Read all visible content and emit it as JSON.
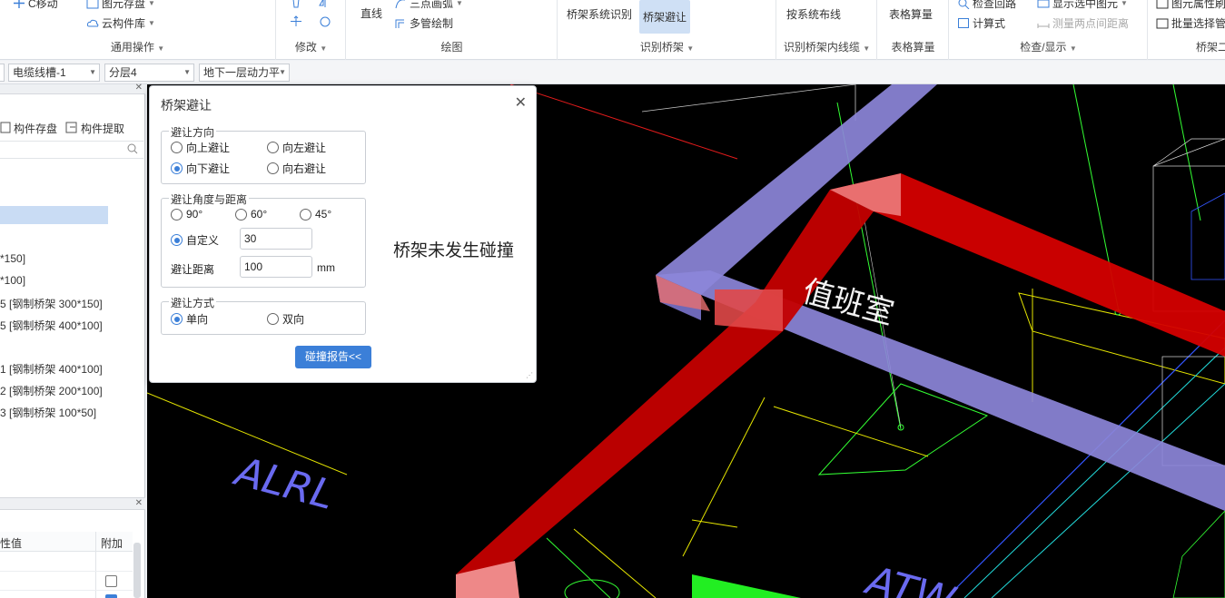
{
  "ribbon": {
    "move": "C移动",
    "save_component": "图元存盘",
    "cloud_library": "云构件库",
    "general_label": "通用操作",
    "modify_label": "修改",
    "line": "直线",
    "three_point_arc": "三点画弧",
    "multi_pipe": "多管绘制",
    "draw_label": "绘图",
    "bridge_recognize": "桥架系统识别",
    "bridge_avoid": "桥架避让",
    "recognize_bridge_label": "识别桥架",
    "by_system_wiring": "按系统布线",
    "recognize_cable_label": "识别桥架内线缆",
    "table_calc": "表格算量",
    "table_calc_label": "表格算量",
    "check_loop": "检查回路",
    "calculator": "计算式",
    "show_selected": "显示选中图元",
    "measure_two_points": "测量两点间距离",
    "check_show_label": "检查/显示",
    "element_property": "图元属性刷",
    "batch_select": "批量选择管",
    "bridge_two_label": "桥架二"
  },
  "toolbar2": {
    "cable_tray": "电缆线槽-1",
    "layer": "分层4",
    "floor": "地下一层动力平"
  },
  "left_panel": {
    "save_btn": "构件存盘",
    "extract_btn": "构件提取",
    "items": [
      "*150]",
      "*100]",
      "5 [钢制桥架 300*150]",
      "5 [钢制桥架 400*100]",
      "1 [钢制桥架 400*100]",
      "2 [钢制桥架 200*100]",
      "3 [钢制桥架 100*50]"
    ],
    "col_value": "性值",
    "col_attach": "附加"
  },
  "dialog": {
    "title": "桥架避让",
    "direction_legend": "避让方向",
    "dir_up": "向上避让",
    "dir_left": "向左避让",
    "dir_down": "向下避让",
    "dir_right": "向右避让",
    "angle_legend": "避让角度与距离",
    "angle_90": "90°",
    "angle_60": "60°",
    "angle_45": "45°",
    "angle_custom": "自定义",
    "custom_value": "30",
    "distance_label": "避让距离",
    "distance_value": "100",
    "distance_unit": "mm",
    "mode_legend": "避让方式",
    "mode_single": "单向",
    "mode_double": "双向",
    "report_btn": "碰撞报告<<",
    "status_message": "桥架未发生碰撞"
  },
  "canvas": {
    "room_label": "值班室",
    "code_label_1": "ALRL",
    "code_label_2": "ATW"
  },
  "colors": {
    "accent": "#3b7fd8",
    "tray_red": "#d40000",
    "tray_purple": "#8c85d9",
    "canvas_bg": "#000000"
  }
}
